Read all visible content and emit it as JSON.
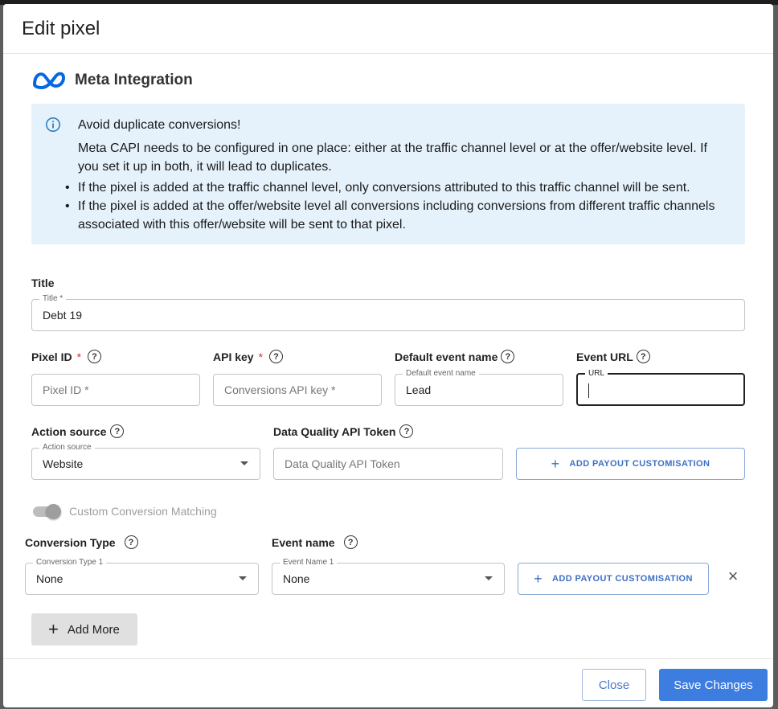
{
  "modal": {
    "title": "Edit pixel"
  },
  "integration": {
    "logo_icon": "meta-logo-icon",
    "title": "Meta Integration"
  },
  "alert": {
    "icon": "info-icon",
    "title": "Avoid duplicate conversions!",
    "body": "Meta CAPI needs to be configured in one place: either at the traffic channel level or at the offer/website level. If you set it up in both, it will lead to duplicates.",
    "bullets": [
      "If the pixel is added at the traffic channel level, only conversions attributed to this traffic channel will be sent.",
      "If the pixel is added at the offer/website level all conversions including conversions from different traffic channels associated with this offer/website will be sent to that pixel."
    ]
  },
  "form": {
    "title_section_label": "Title",
    "title_field": {
      "floating_label": "Title *",
      "value": "Debt 19"
    },
    "pixel_id": {
      "label": "Pixel ID",
      "required_mark": "*",
      "placeholder": "Pixel ID *"
    },
    "api_key": {
      "label": "API key",
      "required_mark": "*",
      "placeholder": "Conversions API key *"
    },
    "default_event": {
      "label": "Default event name",
      "floating_label": "Default event name",
      "value": "Lead"
    },
    "event_url": {
      "label": "Event URL",
      "floating_label": "URL",
      "value": ""
    },
    "action_source": {
      "label": "Action source",
      "floating_label": "Action source",
      "value": "Website"
    },
    "data_quality": {
      "label": "Data Quality API Token",
      "placeholder": "Data Quality API Token"
    },
    "payout_button_1": "ADD PAYOUT CUSTOMISATION",
    "custom_matching": {
      "label": "Custom Conversion Matching",
      "enabled": true,
      "disabled_state": true
    },
    "conversion_type": {
      "label": "Conversion Type",
      "floating_label": "Conversion Type 1",
      "value": "None"
    },
    "event_name": {
      "label": "Event name",
      "floating_label": "Event Name 1",
      "value": "None"
    },
    "payout_button_2": "ADD PAYOUT CUSTOMISATION",
    "add_more": "Add More"
  },
  "help_glyph": "?",
  "footer": {
    "close_label": "Close",
    "save_label": "Save Changes"
  },
  "colors": {
    "primary": "#3d7de0",
    "alert_bg": "#e5f2fb",
    "required": "#d32f2f",
    "meta_blue": "#0668e1"
  }
}
